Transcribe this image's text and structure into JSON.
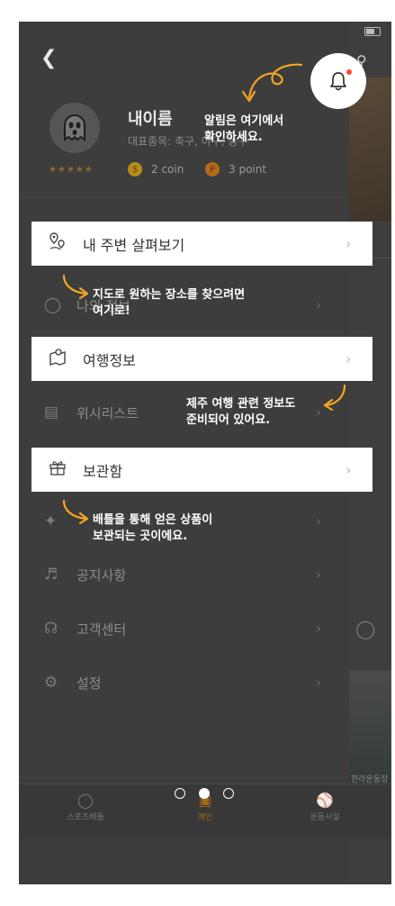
{
  "profile": {
    "name": "내이름",
    "representative": "대표종목: 축구, 야구, 농구",
    "stars": "★★★★★",
    "coin_icon": "$",
    "coin_label": "2 coin",
    "point_icon": "P",
    "point_label": "3 point"
  },
  "menu": {
    "nearby": "내 주변 살펴보기",
    "my": "나의 정보",
    "travel": "여행정보",
    "wishlist": "위시리스트",
    "storage": "보관함",
    "battle": "배틀",
    "notice": "공지사항",
    "support": "고객센터",
    "settings": "설정"
  },
  "tips": {
    "bell_line1": "알림은 여기에서",
    "bell_line2": "확인하세요.",
    "map_line1": "지도로 원하는 장소를 찾으려면",
    "map_line2": "여기로!",
    "travel_line1": "제주 여행 관련 정보도",
    "travel_line2": "준비되어 있어요.",
    "storage_line1": "배틀을 통해 얻은 상품이",
    "storage_line2": "보관되는 곳이에요."
  },
  "bottom_nav": {
    "left": "스포츠배틀",
    "center": "메인",
    "right": "운동시설"
  },
  "background": {
    "caption": "한라운동장"
  },
  "pagination": {
    "current_page": 2,
    "total_pages": 3
  },
  "colors": {
    "accent": "#f5a623",
    "notification_dot": "#ff4a2a",
    "overlay": "#3d3d3d"
  },
  "icons": {
    "back": "chevron-left-icon",
    "bell": "bell-icon",
    "nearby": "map-pin-icon",
    "travel": "map-book-icon",
    "storage": "gift-icon"
  }
}
